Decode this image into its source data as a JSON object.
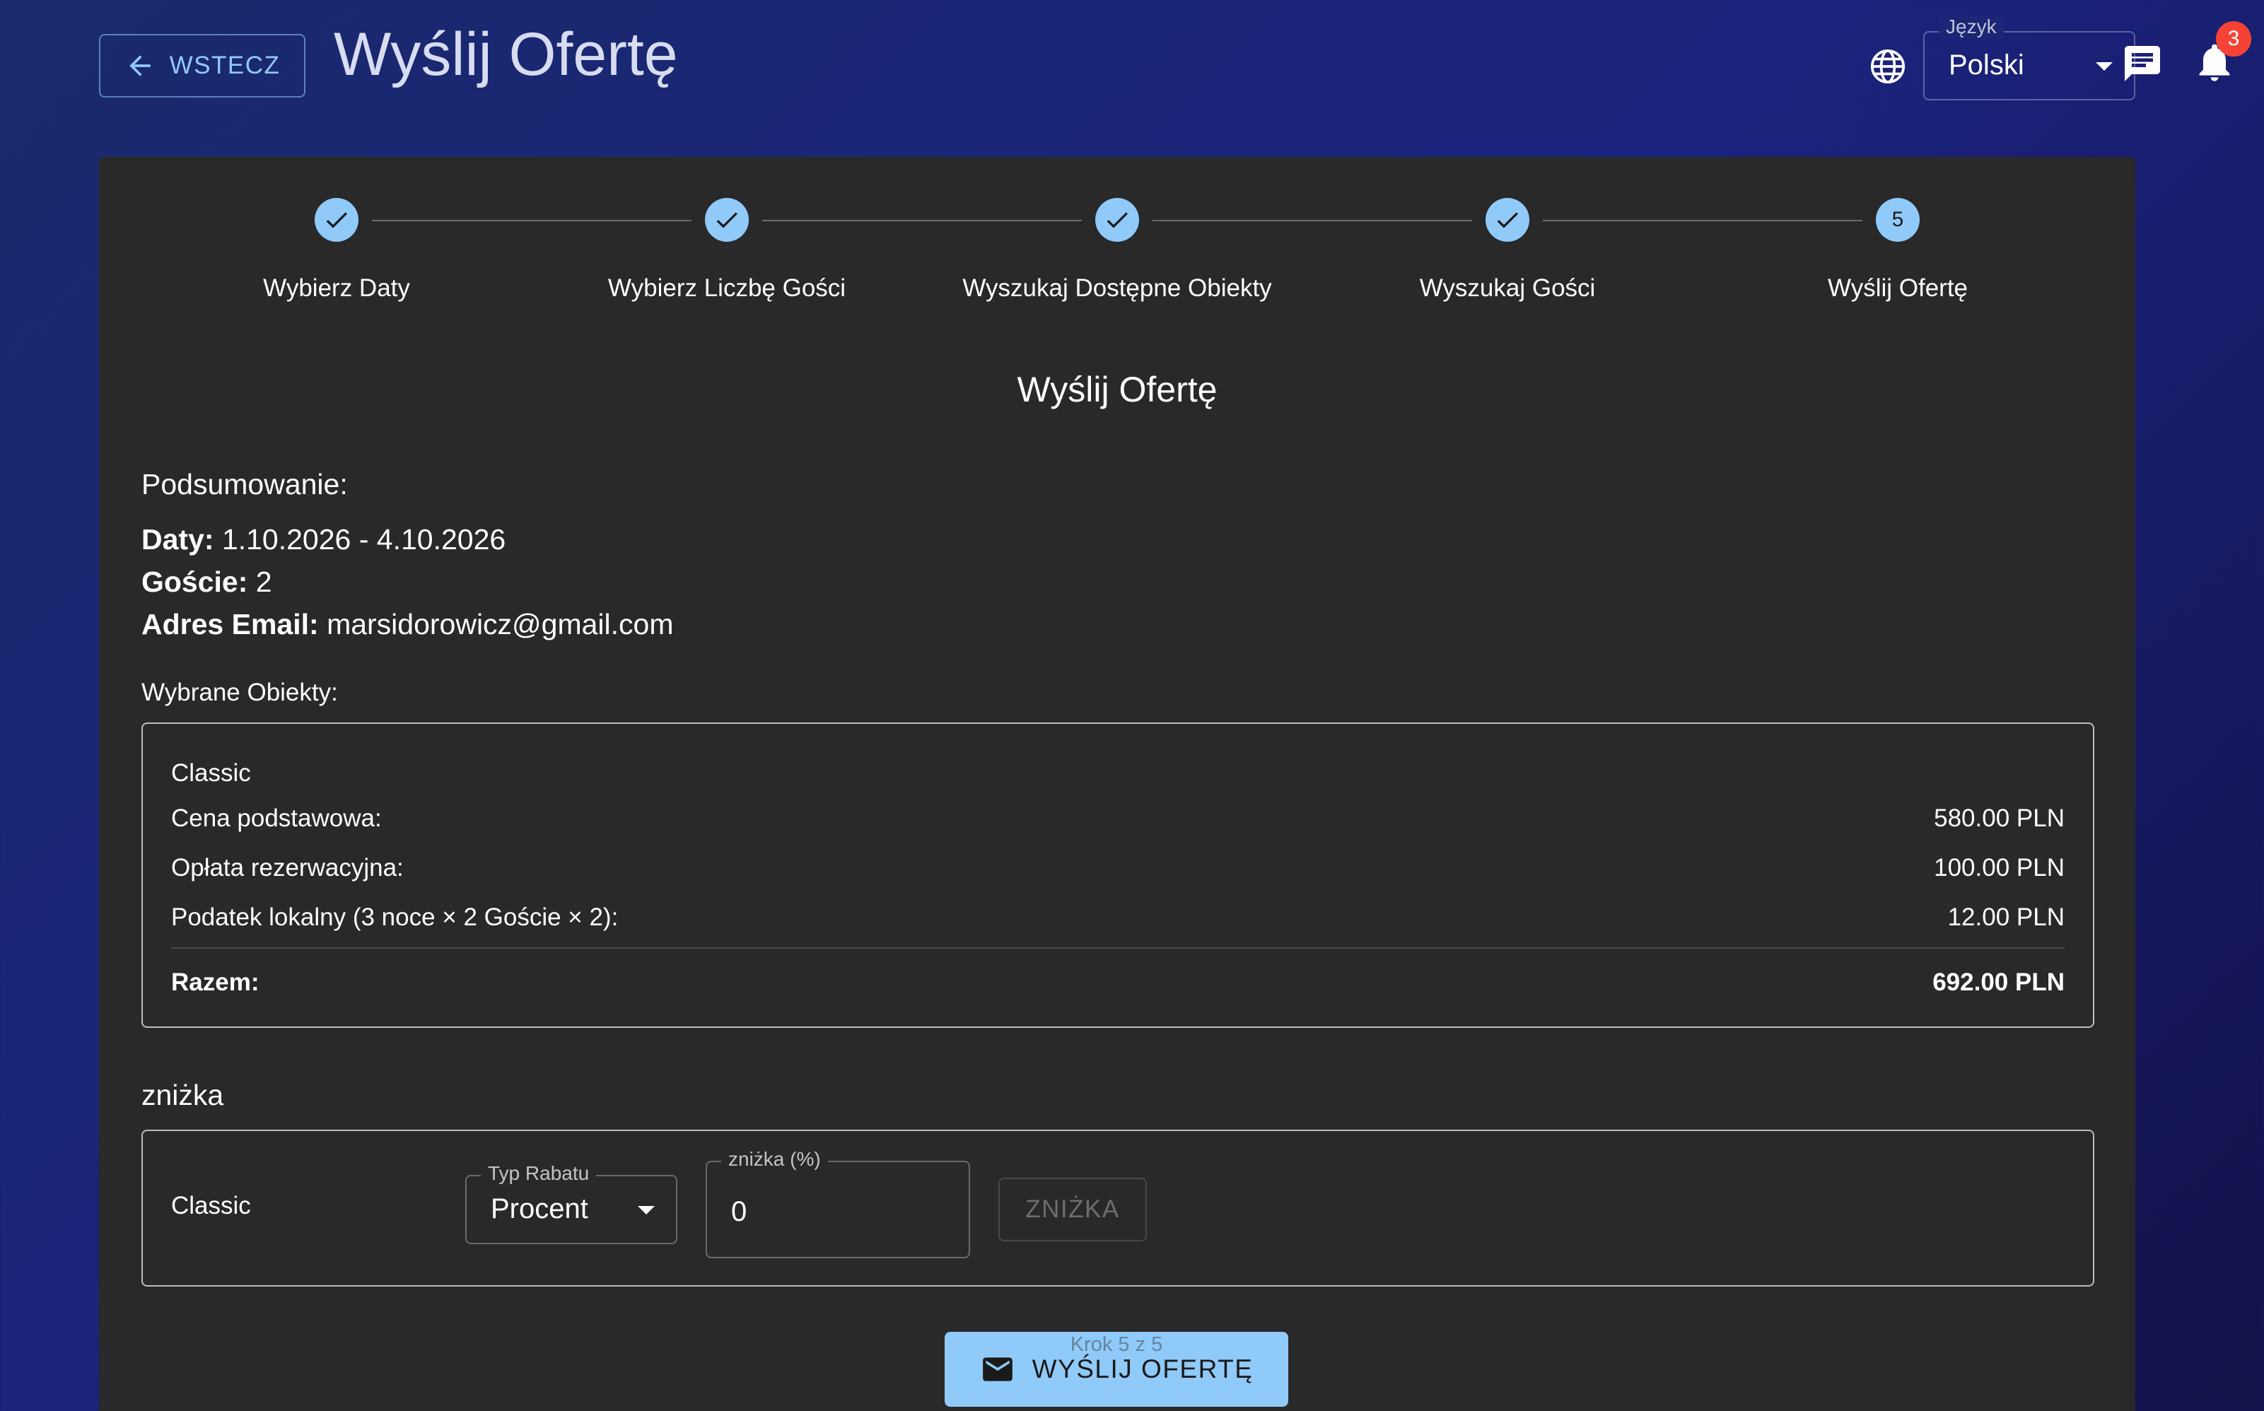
{
  "header": {
    "back_label": "WSTECZ",
    "title": "Wyślij Ofertę",
    "language_label": "Język",
    "language_value": "Polski",
    "notification_count": "3"
  },
  "stepper": {
    "steps": [
      {
        "label": "Wybierz Daty",
        "state": "done"
      },
      {
        "label": "Wybierz Liczbę Gości",
        "state": "done"
      },
      {
        "label": "Wyszukaj Dostępne Obiekty",
        "state": "done"
      },
      {
        "label": "Wyszukaj Gości",
        "state": "done"
      },
      {
        "label": "Wyślij Ofertę",
        "state": "active",
        "number": "5"
      }
    ]
  },
  "section_title": "Wyślij Ofertę",
  "summary": {
    "heading": "Podsumowanie:",
    "dates_label": "Daty:",
    "dates_value": "1.10.2026 - 4.10.2026",
    "guests_label": "Goście:",
    "guests_value": "2",
    "email_label": "Adres Email:",
    "email_value": "marsidorowicz@gmail.com"
  },
  "selected_objects": {
    "heading": "Wybrane Obiekty:",
    "name": "Classic",
    "rows": [
      {
        "label": "Cena podstawowa:",
        "value": "580.00 PLN"
      },
      {
        "label": "Opłata rezerwacyjna:",
        "value": "100.00 PLN"
      },
      {
        "label": "Podatek lokalny (3 noce × 2 Goście × 2):",
        "value": "12.00 PLN"
      }
    ],
    "total_label": "Razem:",
    "total_value": "692.00 PLN"
  },
  "discount": {
    "heading": "zniżka",
    "name": "Classic",
    "type_label": "Typ Rabatu",
    "type_value": "Procent",
    "percent_label": "zniżka (%)",
    "percent_value": "0",
    "apply_label": "ZNIŻKA"
  },
  "footer": {
    "send_label": "WYŚLIJ OFERTĘ",
    "step_counter": "Krok 5 z 5"
  },
  "colors": {
    "accent": "#90caf9",
    "card": "#292929",
    "badge": "#f44336"
  }
}
